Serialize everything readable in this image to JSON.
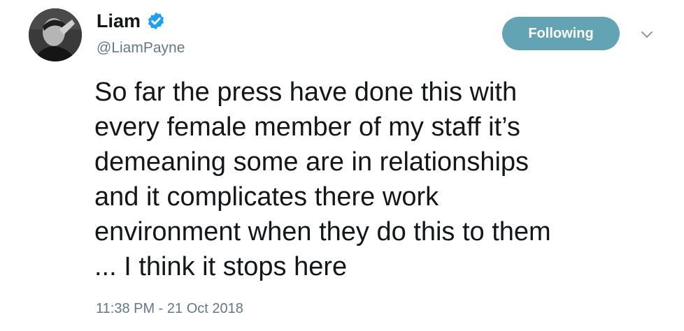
{
  "user": {
    "display_name": "Liam",
    "handle": "@LiamPayne",
    "verified": true,
    "avatar_icon": "user-avatar-photo"
  },
  "actions": {
    "follow_label": "Following",
    "menu_icon": "chevron-down-icon"
  },
  "tweet": {
    "lines": [
      "So far the press have done this with",
      "every female member of my staff it’s",
      "demeaning some are in relationships",
      "and it complicates there work",
      "environment when they do this to them",
      "... I think it stops here"
    ],
    "timestamp": "11:38 PM - 21 Oct 2018"
  },
  "colors": {
    "follow_button_bg": "#62a3b4",
    "verified_badge": "#1da1f2",
    "secondary_text": "#657786",
    "primary_text": "#14171a"
  }
}
